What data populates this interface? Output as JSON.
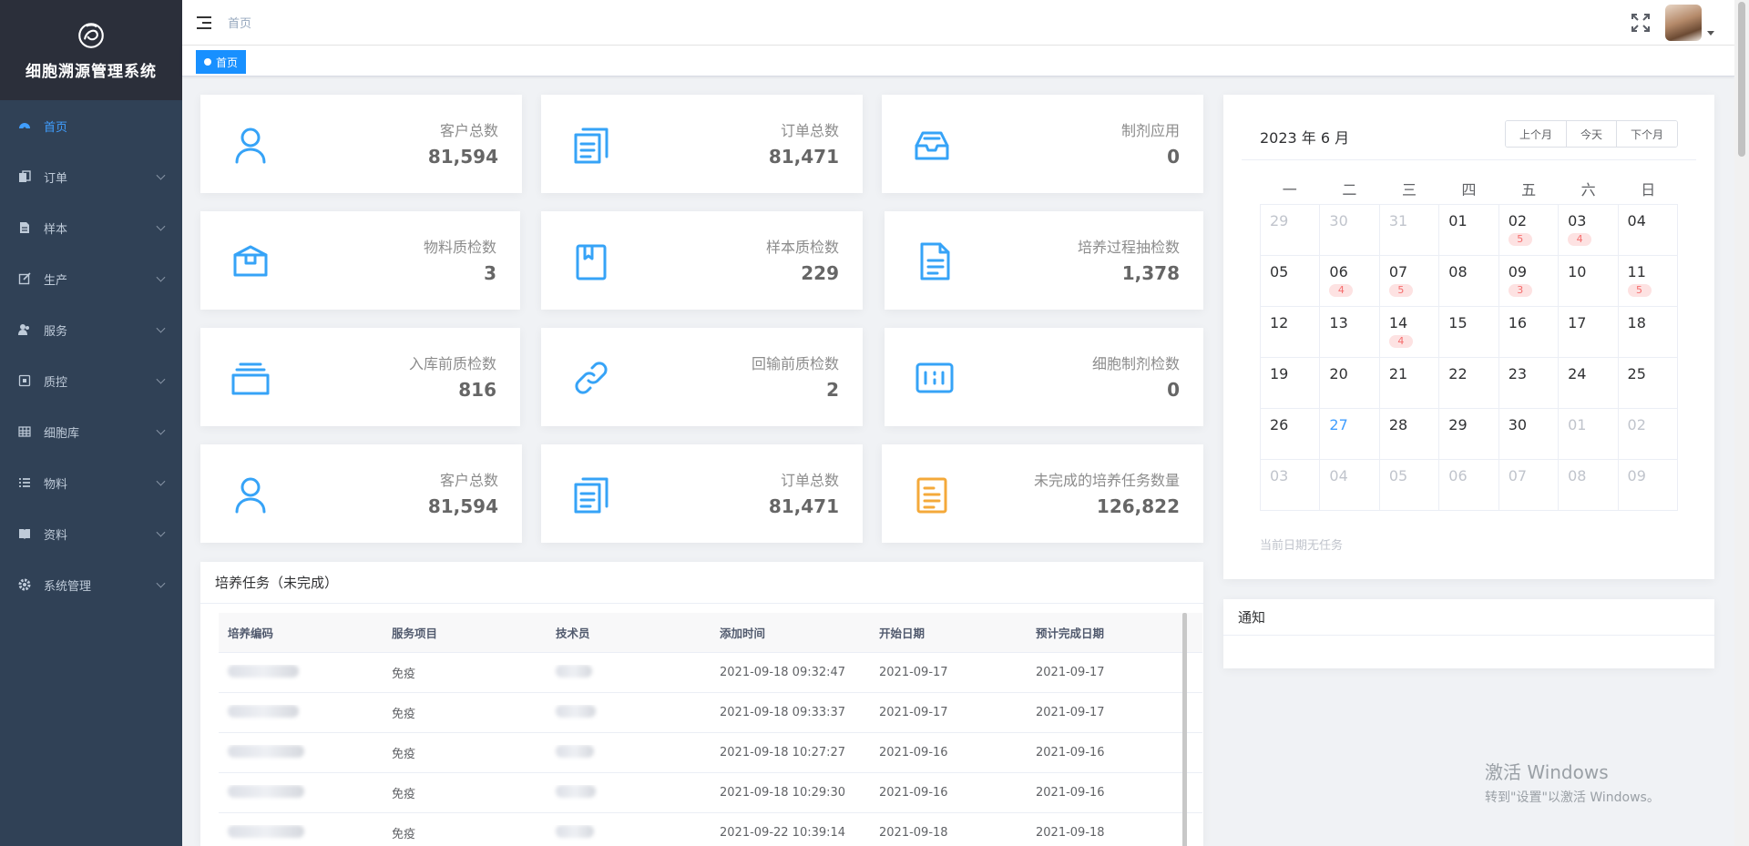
{
  "app": {
    "title": "细胞溯源管理系统"
  },
  "sidebar": {
    "items": [
      {
        "label": "首页",
        "icon": "dashboard-icon",
        "active": true
      },
      {
        "label": "订单",
        "icon": "documents-icon"
      },
      {
        "label": "样本",
        "icon": "file-icon"
      },
      {
        "label": "生产",
        "icon": "edit-icon"
      },
      {
        "label": "服务",
        "icon": "peoples-icon"
      },
      {
        "label": "质控",
        "icon": "checkbox-icon"
      },
      {
        "label": "细胞库",
        "icon": "grid-icon"
      },
      {
        "label": "物料",
        "icon": "list-icon"
      },
      {
        "label": "资料",
        "icon": "book-icon"
      },
      {
        "label": "系统管理",
        "icon": "gear-icon"
      }
    ]
  },
  "navbar": {
    "breadcrumb": "首页"
  },
  "tags": {
    "home": "首页"
  },
  "stats": [
    {
      "label": "客户总数",
      "value": "81,594",
      "icon": "user-icon",
      "color": "#36a3f7"
    },
    {
      "label": "订单总数",
      "value": "81,471",
      "icon": "documents-icon",
      "color": "#36a3f7"
    },
    {
      "label": "制剂应用",
      "value": "0",
      "icon": "inbox-icon",
      "color": "#36a3f7"
    },
    {
      "label": "物料质检数",
      "value": "3",
      "icon": "box-icon",
      "color": "#36a3f7"
    },
    {
      "label": "样本质检数",
      "value": "229",
      "icon": "book-icon",
      "color": "#36a3f7"
    },
    {
      "label": "培养过程抽检数",
      "value": "1,378",
      "icon": "doc-icon",
      "color": "#36a3f7"
    },
    {
      "label": "入库前质检数",
      "value": "816",
      "icon": "stack-icon",
      "color": "#36a3f7"
    },
    {
      "label": "回输前质检数",
      "value": "2",
      "icon": "link-icon",
      "color": "#36a3f7"
    },
    {
      "label": "细胞制剂检数",
      "value": "0",
      "icon": "cells-icon",
      "color": "#36a3f7"
    },
    {
      "label": "客户总数",
      "value": "81,594",
      "icon": "user-icon",
      "color": "#36a3f7"
    },
    {
      "label": "订单总数",
      "value": "81,471",
      "icon": "documents-icon",
      "color": "#36a3f7"
    },
    {
      "label": "未完成的培养任务数量",
      "value": "126,822",
      "icon": "task-icon",
      "color": "#f4a93a"
    }
  ],
  "tasks": {
    "title": "培养任务（未完成）",
    "columns": [
      "培养编码",
      "服务项目",
      "技术员",
      "添加时间",
      "开始日期",
      "预计完成日期"
    ],
    "rows": [
      {
        "service": "免疫",
        "added": "2021-09-18 09:32:47",
        "start": "2021-09-17",
        "due": "2021-09-17"
      },
      {
        "service": "免疫",
        "added": "2021-09-18 09:33:37",
        "start": "2021-09-17",
        "due": "2021-09-17"
      },
      {
        "service": "免疫",
        "added": "2021-09-18 10:27:27",
        "start": "2021-09-16",
        "due": "2021-09-16"
      },
      {
        "service": "免疫",
        "added": "2021-09-18 10:29:30",
        "start": "2021-09-16",
        "due": "2021-09-16"
      },
      {
        "service": "免疫",
        "added": "2021-09-22 10:39:14",
        "start": "2021-09-18",
        "due": "2021-09-18"
      }
    ]
  },
  "calendar": {
    "title": "2023 年 6 月",
    "buttons": [
      "上个月",
      "今天",
      "下个月"
    ],
    "weekdays": [
      "一",
      "二",
      "三",
      "四",
      "五",
      "六",
      "日"
    ],
    "weeks": [
      [
        {
          "d": "29",
          "m": true
        },
        {
          "d": "30",
          "m": true
        },
        {
          "d": "31",
          "m": true
        },
        {
          "d": "01"
        },
        {
          "d": "02",
          "b": "5"
        },
        {
          "d": "03",
          "b": "4"
        },
        {
          "d": "04"
        }
      ],
      [
        {
          "d": "05"
        },
        {
          "d": "06",
          "b": "4"
        },
        {
          "d": "07",
          "b": "5"
        },
        {
          "d": "08"
        },
        {
          "d": "09",
          "b": "3"
        },
        {
          "d": "10"
        },
        {
          "d": "11",
          "b": "5"
        }
      ],
      [
        {
          "d": "12"
        },
        {
          "d": "13"
        },
        {
          "d": "14",
          "b": "4"
        },
        {
          "d": "15"
        },
        {
          "d": "16"
        },
        {
          "d": "17"
        },
        {
          "d": "18"
        }
      ],
      [
        {
          "d": "19"
        },
        {
          "d": "20"
        },
        {
          "d": "21"
        },
        {
          "d": "22"
        },
        {
          "d": "23"
        },
        {
          "d": "24"
        },
        {
          "d": "25"
        }
      ],
      [
        {
          "d": "26"
        },
        {
          "d": "27",
          "t": true
        },
        {
          "d": "28"
        },
        {
          "d": "29"
        },
        {
          "d": "30"
        },
        {
          "d": "01",
          "m": true
        },
        {
          "d": "02",
          "m": true
        }
      ],
      [
        {
          "d": "03",
          "m": true
        },
        {
          "d": "04",
          "m": true
        },
        {
          "d": "05",
          "m": true
        },
        {
          "d": "06",
          "m": true
        },
        {
          "d": "07",
          "m": true
        },
        {
          "d": "08",
          "m": true
        },
        {
          "d": "09",
          "m": true
        }
      ]
    ],
    "empty_text": "当前日期无任务"
  },
  "notice": {
    "title": "通知"
  },
  "watermark": {
    "line1": "激活 Windows",
    "line2": "转到\"设置\"以激活 Windows。"
  }
}
